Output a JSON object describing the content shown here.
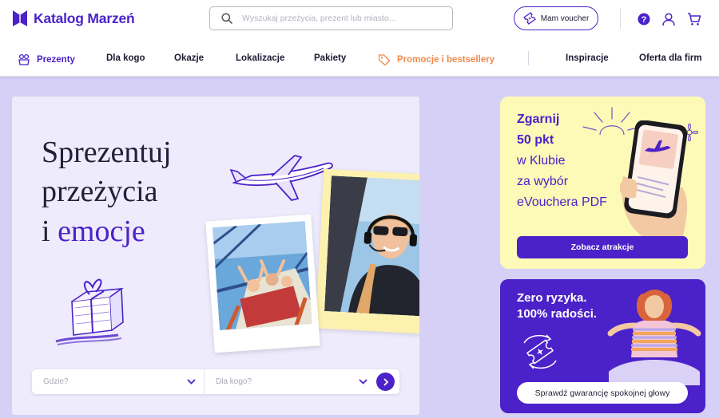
{
  "header": {
    "logo_text": "Katalog Marzeń",
    "search_placeholder": "Wyszukaj przeżycia, prezent lub miasto...",
    "voucher_label": "Mam voucher"
  },
  "nav": {
    "items": [
      {
        "label": "Prezenty"
      },
      {
        "label": "Dla kogo"
      },
      {
        "label": "Okazje"
      },
      {
        "label": "Lokalizacje"
      },
      {
        "label": "Pakiety"
      },
      {
        "label": "Promocje i bestsellery"
      },
      {
        "label": "Inspiracje"
      },
      {
        "label": "Oferta dla firm"
      }
    ]
  },
  "hero": {
    "title_line1": "Sprezentuj",
    "title_line2": "przeżycia",
    "title_line3_prefix": "i",
    "title_line3_accent": "emocje",
    "where_placeholder": "Gdzie?",
    "who_placeholder": "Dla kogo?"
  },
  "promo_card": {
    "line1": "Zgarnij",
    "line2": "50 pkt",
    "line3": "w Klubie",
    "line4": "za wybór",
    "line5": "eVouchera PDF",
    "button": "Zobacz atrakcje"
  },
  "guarantee_card": {
    "line1": "Zero ryzyka.",
    "line2": "100% radości.",
    "button": "Sprawdź gwarancję spokojnej głowy"
  },
  "colors": {
    "brand": "#4b22c9",
    "promo": "#f08a4b",
    "page_bg": "#d6d0f7",
    "hero_bg": "#eeebfc",
    "yellow_card": "#fdf9b7"
  }
}
